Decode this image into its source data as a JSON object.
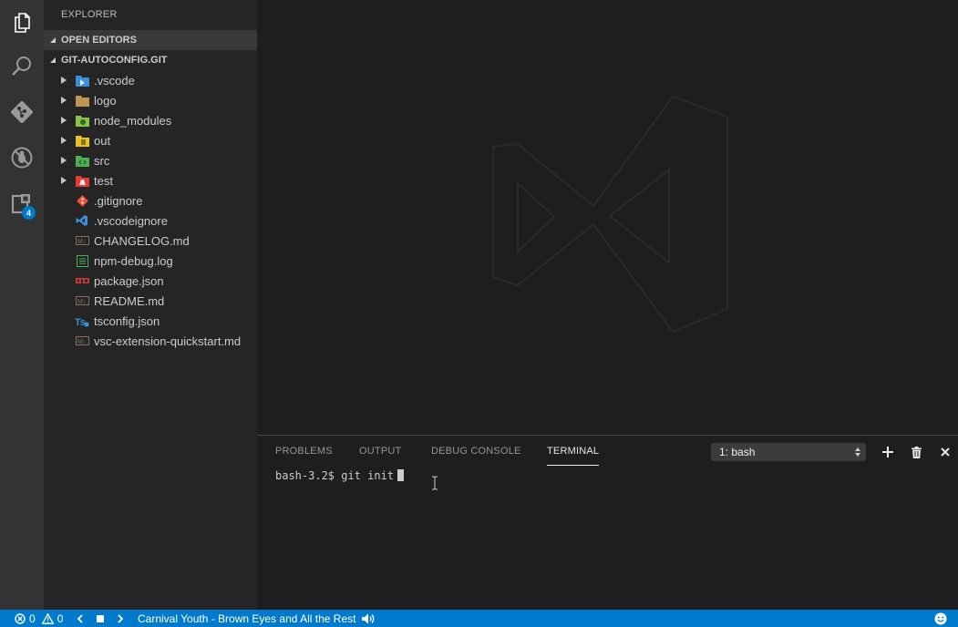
{
  "activity_bar": {
    "items": [
      {
        "name": "explorer",
        "icon": "files-icon"
      },
      {
        "name": "search",
        "icon": "search-icon"
      },
      {
        "name": "source-control",
        "icon": "git-icon"
      },
      {
        "name": "debug",
        "icon": "debug-icon"
      },
      {
        "name": "extensions",
        "icon": "extensions-icon",
        "badge": "4"
      }
    ]
  },
  "sidebar": {
    "title": "EXPLORER",
    "open_editors_label": "OPEN EDITORS",
    "project_label": "GIT-AUTOCONFIG.GIT",
    "tree": [
      {
        "label": ".vscode",
        "type": "folder",
        "icon": "vscode-folder-icon",
        "color": "#3a8fd6"
      },
      {
        "label": "logo",
        "type": "folder",
        "icon": "folder-icon",
        "color": "#c09553"
      },
      {
        "label": "node_modules",
        "type": "folder",
        "icon": "node-folder-icon",
        "color": "#8bc34a"
      },
      {
        "label": "out",
        "type": "folder",
        "icon": "out-folder-icon",
        "color": "#e6c229"
      },
      {
        "label": "src",
        "type": "folder",
        "icon": "src-folder-icon",
        "color": "#4caf50"
      },
      {
        "label": "test",
        "type": "folder",
        "icon": "test-folder-icon",
        "color": "#e53935"
      },
      {
        "label": ".gitignore",
        "type": "file",
        "icon": "git-file-icon",
        "color": "#f14e32"
      },
      {
        "label": ".vscodeignore",
        "type": "file",
        "icon": "vscode-file-icon",
        "color": "#3a8fd6"
      },
      {
        "label": "CHANGELOG.md",
        "type": "file",
        "icon": "markdown-icon",
        "color": "#8d6e63"
      },
      {
        "label": "npm-debug.log",
        "type": "file",
        "icon": "log-icon",
        "color": "#4caf50"
      },
      {
        "label": "package.json",
        "type": "file",
        "icon": "npm-icon",
        "color": "#cb3837"
      },
      {
        "label": "README.md",
        "type": "file",
        "icon": "markdown-icon",
        "color": "#8d6e63"
      },
      {
        "label": "tsconfig.json",
        "type": "file",
        "icon": "typescript-icon",
        "color": "#3a8fd6"
      },
      {
        "label": "vsc-extension-quickstart.md",
        "type": "file",
        "icon": "markdown-icon",
        "color": "#8d6e63"
      }
    ]
  },
  "panel": {
    "tabs": [
      {
        "label": "PROBLEMS",
        "active": false
      },
      {
        "label": "OUTPUT",
        "active": false
      },
      {
        "label": "DEBUG CONSOLE",
        "active": false
      },
      {
        "label": "TERMINAL",
        "active": true
      }
    ],
    "terminal_selector": "1: bash",
    "prompt": "bash-3.2$ git init"
  },
  "statusbar": {
    "errors": "0",
    "warnings": "0",
    "track": "Carnival Youth - Brown Eyes and All the Rest"
  },
  "colors": {
    "accent": "#007acc",
    "sidebar_bg": "#252526",
    "editor_bg": "#1e1e1e",
    "activity_bg": "#333333"
  }
}
